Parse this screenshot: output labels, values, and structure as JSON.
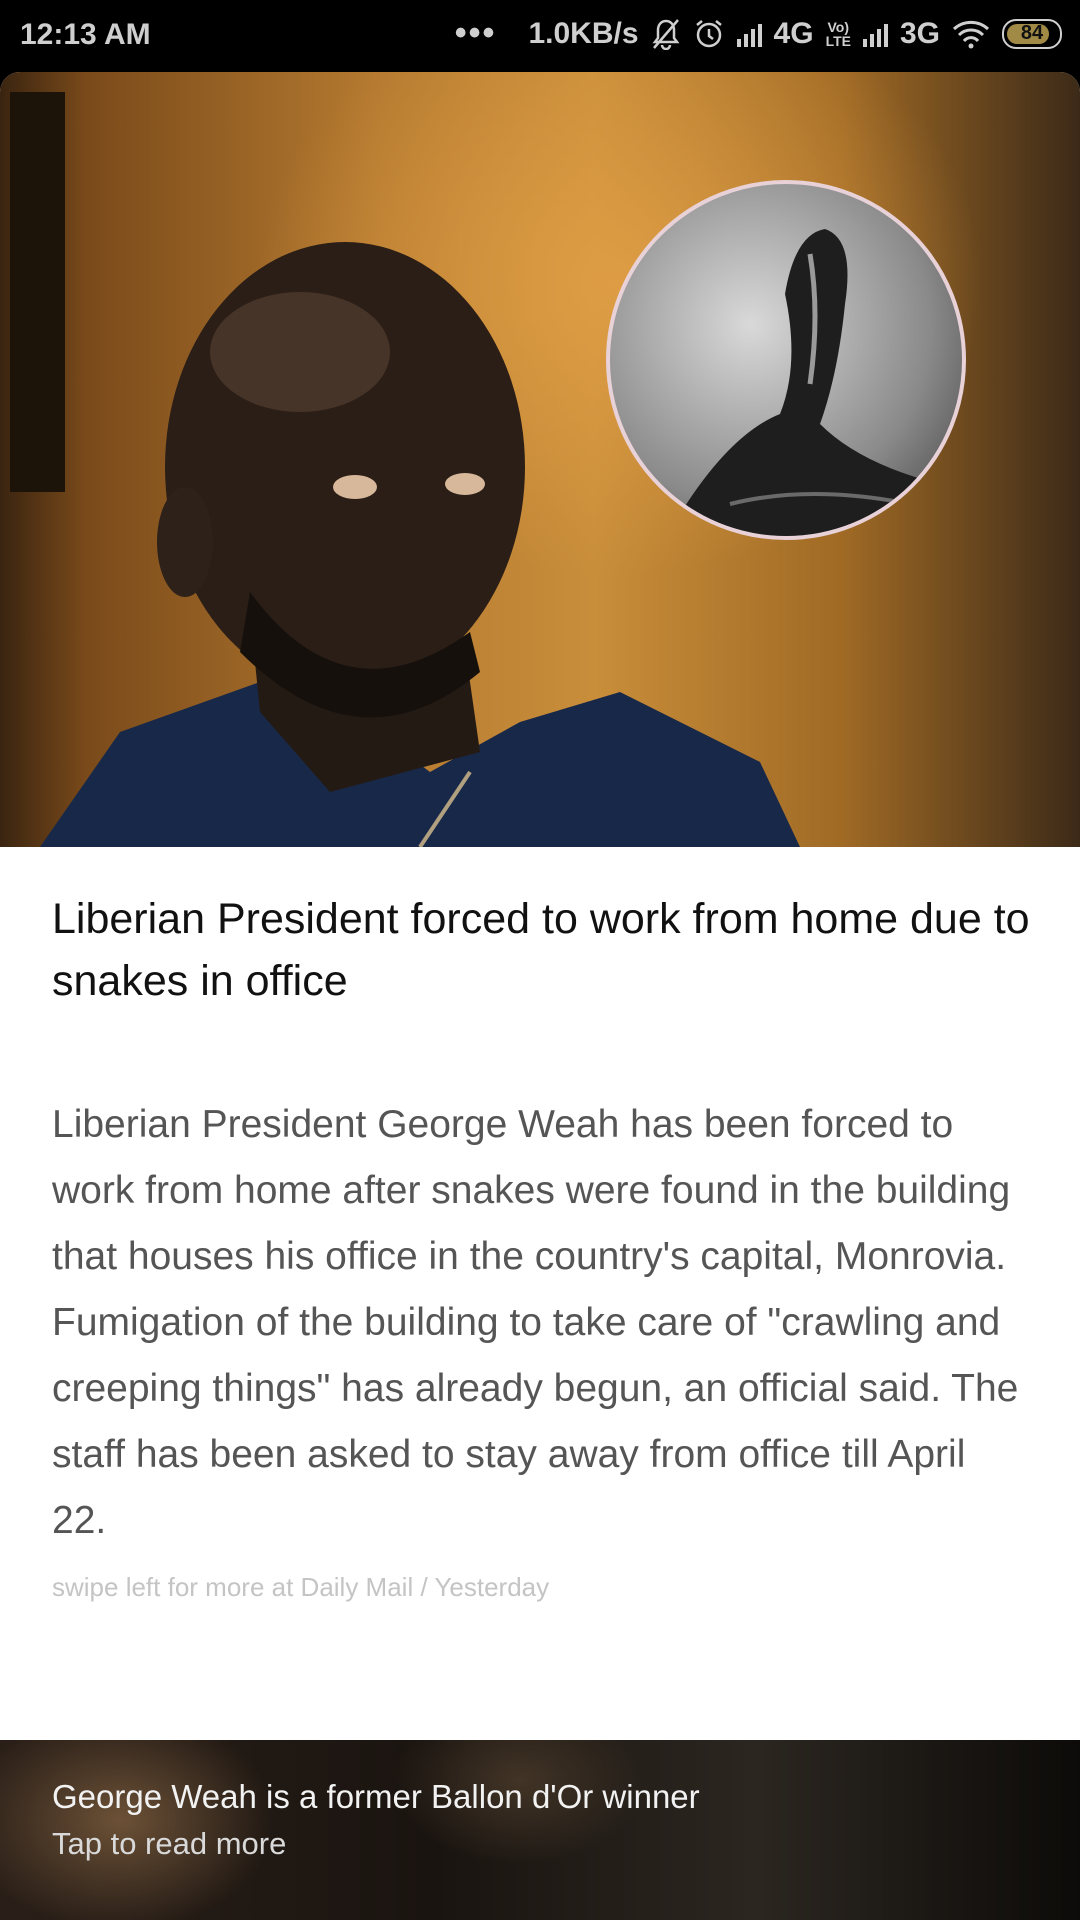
{
  "status_bar": {
    "time": "12:13 AM",
    "dots": "•••",
    "speed": "1.0KB/s",
    "network_1": "4G",
    "volte_top": "Vo)",
    "volte_bottom": "LTE",
    "network_2": "3G",
    "battery_level": "84",
    "icons": [
      "mute-bell-icon",
      "alarm-icon",
      "signal-icon",
      "signal-icon",
      "wifi-icon",
      "battery-icon"
    ]
  },
  "article": {
    "headline": "Liberian President forced to work from home due to snakes in office",
    "summary": "Liberian President George Weah has been forced to work from home after snakes were found in the building that houses his office in the country's capital, Monrovia. Fumigation of the building to take care of \"crawling and creeping things\" has already begun, an official said. The staff has been asked to stay away from office till April 22.",
    "source_prefix": "swipe left for more at Daily Mail",
    "source_separator": " / ",
    "source_time": "Yesterday"
  },
  "banner": {
    "title": "George Weah is a former Ballon d'Or winner",
    "subtitle": "Tap to read more"
  }
}
